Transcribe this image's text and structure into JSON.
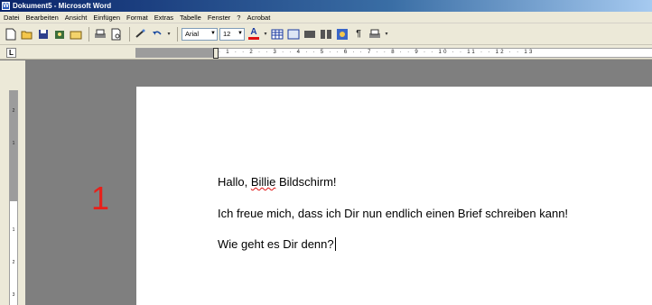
{
  "window": {
    "title": "Dokument5 - Microsoft Word",
    "app_icon": "W"
  },
  "menu": {
    "items": [
      "Datei",
      "Bearbeiten",
      "Ansicht",
      "Einfügen",
      "Format",
      "Extras",
      "Tabelle",
      "Fenster",
      "?",
      "Acrobat"
    ]
  },
  "toolbar": {
    "font_name": "Arial",
    "font_size": "12",
    "font_color_glyph": "A",
    "pilcrow_glyph": "¶"
  },
  "ruler": {
    "tab_selector": "L",
    "h_ticks": "· 1 · · 2 · · 3 · · 4 · · 5 · · 6 · · 7 · · 8 · · 9 · · 10 · · 11 · · 12 · · 13",
    "v_ticks": [
      "2",
      "1",
      "1",
      "2",
      "3"
    ]
  },
  "annotation": {
    "page_marker": "1",
    "color": "#e8201a"
  },
  "document": {
    "line1_greeting": "Hallo, ",
    "line1_name": "Billie",
    "line1_rest": " Bildschirm!",
    "line2": "Ich freue mich, dass ich Dir nun endlich einen Brief schreiben kann!",
    "line3": "Wie geht es Dir denn?"
  }
}
